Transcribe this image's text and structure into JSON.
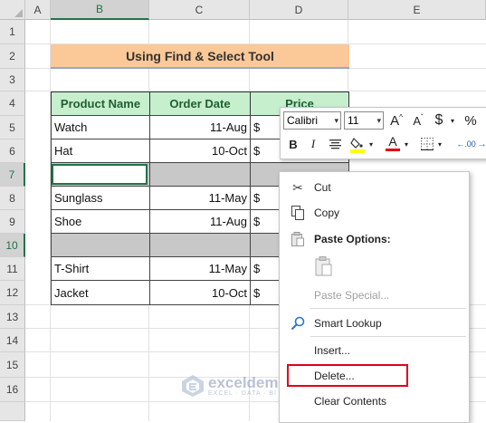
{
  "columns": [
    "A",
    "B",
    "C",
    "D",
    "E"
  ],
  "rows": [
    "1",
    "2",
    "3",
    "4",
    "5",
    "6",
    "7",
    "8",
    "9",
    "10",
    "11",
    "12",
    "13",
    "14",
    "15",
    "16"
  ],
  "title": "Using Find & Select Tool",
  "table": {
    "headers": [
      "Product Name",
      "Order Date",
      "Price"
    ],
    "rows": [
      {
        "name": "Watch",
        "date": "11-Aug",
        "price": "$"
      },
      {
        "name": "Hat",
        "date": "10-Oct",
        "price": "$"
      },
      {
        "name": "",
        "date": "",
        "price": ""
      },
      {
        "name": "Sunglass",
        "date": "11-May",
        "price": "$"
      },
      {
        "name": "Shoe",
        "date": "11-Aug",
        "price": "$"
      },
      {
        "name": "",
        "date": "",
        "price": ""
      },
      {
        "name": "T-Shirt",
        "date": "11-May",
        "price": "$"
      },
      {
        "name": "Jacket",
        "date": "10-Oct",
        "price": "$"
      }
    ]
  },
  "mini_toolbar": {
    "font_name": "Calibri",
    "font_size": "11",
    "increase_font": "A",
    "decrease_font": "A",
    "currency": "$",
    "percent": "%",
    "bold": "B",
    "italic": "I",
    "font_color": "A",
    "highlight_color": "#ffff00",
    "font_color_value": "#e00000",
    "dec_places": ".00"
  },
  "context_menu": {
    "cut": "Cut",
    "copy": "Copy",
    "paste_options": "Paste Options:",
    "paste_special": "Paste Special...",
    "smart_lookup": "Smart Lookup",
    "insert": "Insert...",
    "delete": "Delete...",
    "clear_contents": "Clear Contents"
  },
  "watermark": {
    "name": "exceldemy",
    "tagline": "EXCEL · DATA · BI"
  },
  "colors": {
    "header_green": "#c6efce",
    "title_orange": "#fbc898",
    "selected_gray": "#c8c8c8",
    "highlight_red": "#e0001b"
  }
}
